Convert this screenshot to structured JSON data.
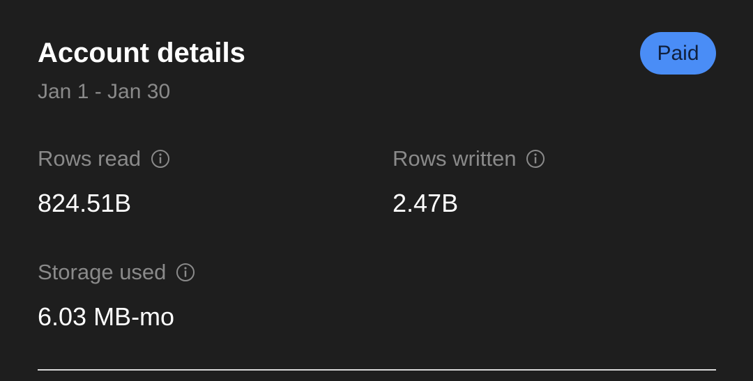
{
  "card": {
    "title": "Account details",
    "date_range": "Jan 1 - Jan 30",
    "badge": "Paid"
  },
  "metrics": [
    {
      "label": "Rows read",
      "value": "824.51B",
      "icon": "info-icon"
    },
    {
      "label": "Rows written",
      "value": "2.47B",
      "icon": "info-icon"
    },
    {
      "label": "Storage used",
      "value": "6.03 MB-mo",
      "icon": "info-icon"
    }
  ],
  "colors": {
    "background": "#1e1e1e",
    "badge": "#4a8df6",
    "muted_text": "#8a8a8a",
    "primary_text": "#ffffff"
  }
}
